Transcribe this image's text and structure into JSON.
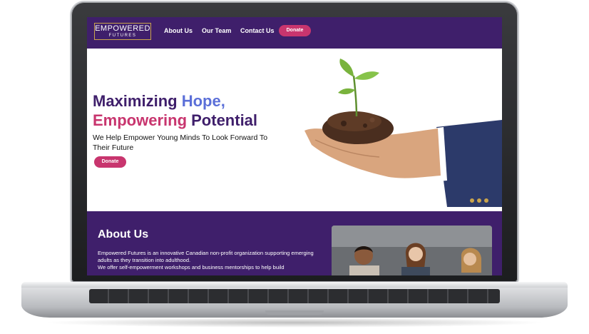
{
  "site": {
    "logo": {
      "main": "EMPOWERED",
      "sub": "FUTURES"
    },
    "nav": {
      "links": [
        "About Us",
        "Our Team",
        "Contact Us"
      ],
      "donate_label": "Donate"
    },
    "hero": {
      "headline_line1_a": "Maximizing ",
      "headline_line1_b": "Hope,",
      "headline_line2_a": "Empowering",
      "headline_line2_b": " Potential",
      "subheading": "We Help Empower Young Minds To Look Forward To Their Future",
      "donate_label": "Donate",
      "image_icon": "seedling-in-hand"
    },
    "about": {
      "title": "About Us",
      "body_line1": "Empowered Futures is an innovative Canadian non-profit organization supporting emerging adults as they transition into adulthood.",
      "body_line2": "We offer self-empowerment workshops and business mentorships to help build"
    },
    "colors": {
      "brand_purple": "#3f1f6b",
      "accent_pink": "#c8356e",
      "accent_blue": "#5b6fd8",
      "logo_gold": "#c9a44c"
    }
  }
}
